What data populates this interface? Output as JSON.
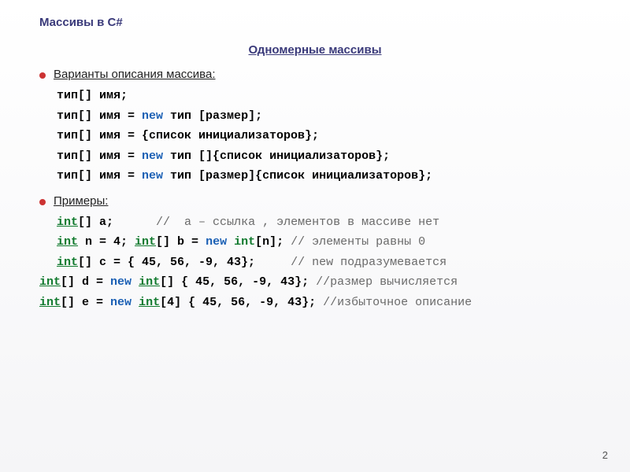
{
  "slide": {
    "title": "Массивы в C#",
    "section_title": "Одномерные массивы",
    "variants_heading": "Варианты описания массива:",
    "code_variants": {
      "l1": "тип[] имя;",
      "l2_a": "тип[] имя = ",
      "l2_new": "new",
      "l2_b": " тип [размер];",
      "l3": "тип[] имя = {список инициализаторов};",
      "l4_a": "тип[] имя = ",
      "l4_new": "new",
      "l4_b": " тип []{список инициализаторов};",
      "l5_a": "тип[] имя = ",
      "l5_new": "new",
      "l5_b": " тип [размер]{список инициализаторов};"
    },
    "examples_heading": "Примеры:",
    "code_examples": {
      "e1_int": "int",
      "e1_a": "[] a;      ",
      "e1_c": "//  a – ссылка , элементов в массиве нет",
      "e2_int": "int",
      "e2_a": " n = 4; ",
      "e2_int2": "int",
      "e2_b": "[] b = ",
      "e2_new": "new",
      "e2_c": " ",
      "e2_int3": "int",
      "e2_d": "[n]; ",
      "e2_cm": "// элементы равны 0",
      "e3_int": "int",
      "e3_a": "[] c = { 45, 56, -9, 43};     ",
      "e3_cm": "// new подразумевается",
      "e4_int": "int",
      "e4_a": "[] d = ",
      "e4_new": "new",
      "e4_b": " ",
      "e4_int2": "int",
      "e4_c": "[] { 45, 56, -9, 43}; ",
      "e4_cm": "//размер вычисляется",
      "e5_int": "int",
      "e5_a": "[] e = ",
      "e5_new": "new",
      "e5_b": " ",
      "e5_int2": "int",
      "e5_c": "[4] { 45, 56, -9, 43}; ",
      "e5_cm": "//избыточное описание"
    },
    "page_number": "2"
  }
}
